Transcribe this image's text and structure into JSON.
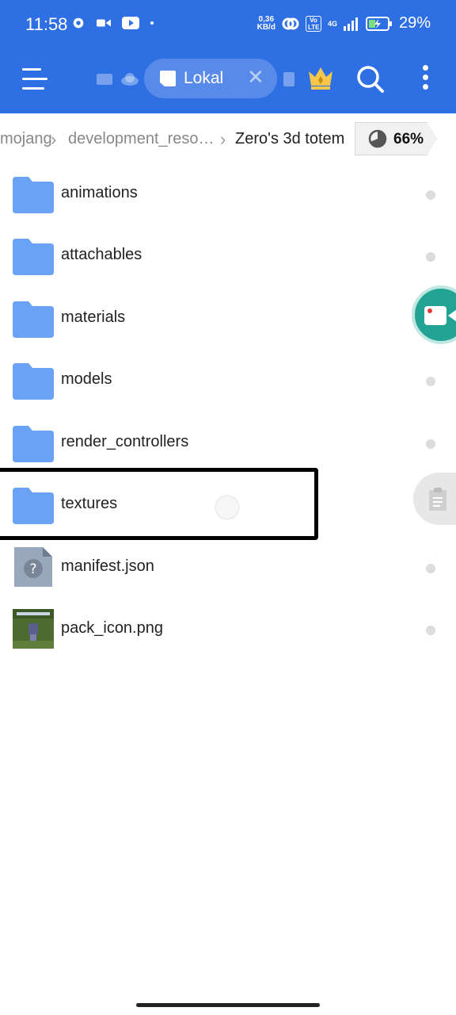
{
  "status_bar": {
    "time": "11:58",
    "net_speed_value": "0,36",
    "net_speed_unit": "KB/d",
    "volte": "Vo LTE",
    "network": "4G",
    "battery": "29%"
  },
  "toolbar": {
    "active_tab": "Lokal"
  },
  "breadcrumb": {
    "items": [
      "mojang",
      "development_reso…",
      "Zero's 3d totem"
    ],
    "storage_percent": "66%"
  },
  "files": [
    {
      "name": "animations",
      "type": "folder"
    },
    {
      "name": "attachables",
      "type": "folder"
    },
    {
      "name": "materials",
      "type": "folder"
    },
    {
      "name": "models",
      "type": "folder"
    },
    {
      "name": "render_controllers",
      "type": "folder"
    },
    {
      "name": "textures",
      "type": "folder"
    },
    {
      "name": "manifest.json",
      "type": "unknown-file"
    },
    {
      "name": "pack_icon.png",
      "type": "image"
    }
  ],
  "colors": {
    "primary": "#2f6fe4",
    "folder": "#6aa3f5",
    "recorder": "#22a394"
  }
}
